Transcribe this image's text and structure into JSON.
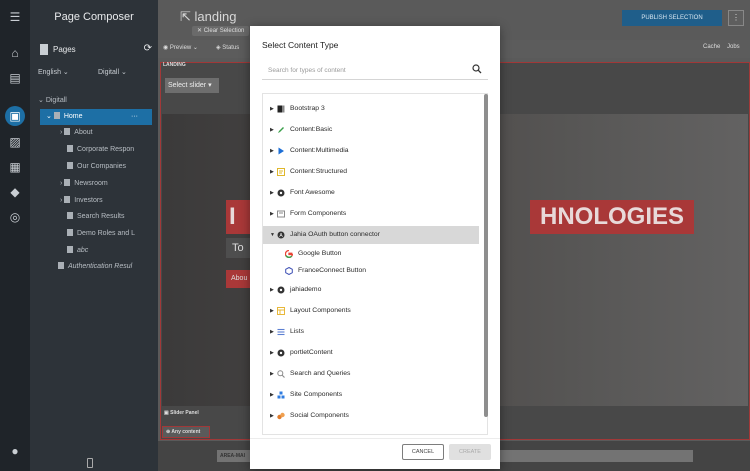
{
  "sidebar": {
    "title": "Page Composer",
    "pages_label": "Pages",
    "language": "English",
    "site": "Digitall",
    "tree": [
      {
        "label": "Digitall"
      },
      {
        "label": "Home"
      },
      {
        "label": "About"
      },
      {
        "label": "Corporate Respon"
      },
      {
        "label": "Our Companies"
      },
      {
        "label": "Newsroom"
      },
      {
        "label": "Investors"
      },
      {
        "label": "Search Results"
      },
      {
        "label": "Demo Roles and L"
      },
      {
        "label": "abc"
      },
      {
        "label": "Authentication Resul"
      }
    ]
  },
  "header": {
    "page_title": "landing",
    "clear_selection": "✕ Clear Selection",
    "publish_label": "PUBLISH SELECTION",
    "preview_label": "Preview",
    "status_label": "Status",
    "cache_label": "Cache",
    "jobs_label": "Jobs"
  },
  "canvas": {
    "area_label": "LANDING",
    "select_slider": "Select slider",
    "hero_text_left": "I",
    "hero_text_right": "HNOLOGIES",
    "hero_to": "To",
    "hero_about": "Abou",
    "slider_panel": "Slider Panel",
    "any_content": "Any content",
    "area_main": "AREA-MAI"
  },
  "modal": {
    "title": "Select Content Type",
    "search_placeholder": "Search for types of content",
    "items": [
      {
        "label": "Bootstrap 3",
        "icon": "bootstrap-icon",
        "color": "#222222"
      },
      {
        "label": "Content:Basic",
        "icon": "pencil-icon",
        "color": "#3aa04a"
      },
      {
        "label": "Content:Multimedia",
        "icon": "play-icon",
        "color": "#1d6fd6"
      },
      {
        "label": "Content:Structured",
        "icon": "note-icon",
        "color": "#e0b72a"
      },
      {
        "label": "Font Awesome",
        "icon": "fa-icon",
        "color": "#333333"
      },
      {
        "label": "Form Components",
        "icon": "form-icon",
        "color": "#8a8a8a"
      },
      {
        "label": "Jahia OAuth button connector",
        "icon": "oauth-icon",
        "color": "#333333"
      },
      {
        "label": "Google Button",
        "icon": "google-icon",
        "color": "#4285f4"
      },
      {
        "label": "FranceConnect Button",
        "icon": "franceconnect-icon",
        "color": "#3f51b5"
      },
      {
        "label": "jahiademo",
        "icon": "jahia-icon",
        "color": "#333333"
      },
      {
        "label": "Layout Components",
        "icon": "layout-icon",
        "color": "#e8b83a"
      },
      {
        "label": "Lists",
        "icon": "list-icon",
        "color": "#5b7fd1"
      },
      {
        "label": "portletContent",
        "icon": "portlet-icon",
        "color": "#333333"
      },
      {
        "label": "Search and Queries",
        "icon": "search-queries-icon",
        "color": "#8a8a8a"
      },
      {
        "label": "Site Components",
        "icon": "site-icon",
        "color": "#2f7ce0"
      },
      {
        "label": "Social Components",
        "icon": "social-icon",
        "color": "#e07b2a"
      }
    ],
    "cancel_label": "CANCEL",
    "create_label": "CREATE"
  }
}
